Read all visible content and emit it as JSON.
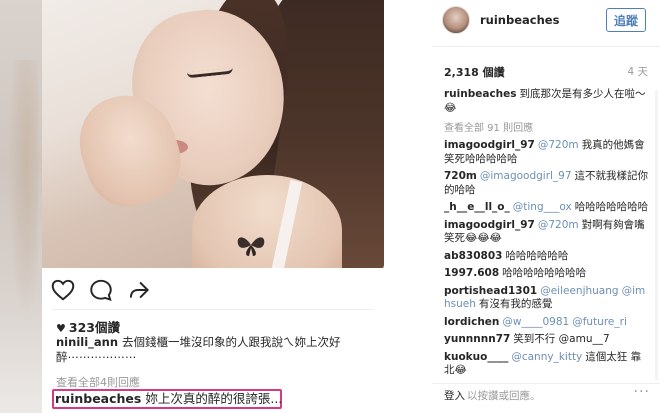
{
  "post": {
    "likes_label": "323個讚",
    "comments": [
      {
        "user": "ninili_ann",
        "text": "去個錢櫃一堆沒印象的人跟我說ㄟ妳上次好醉⋯⋯⋯⋯⋯⋯"
      }
    ],
    "view_all_label": "查看全部4則回應",
    "highlighted_comment": {
      "user": "ruinbeaches",
      "text": "妳上次真的醉的很誇張..."
    }
  },
  "side": {
    "username": "ruinbeaches",
    "follow_label": "追蹤",
    "likes_count": "2,318 個讚",
    "age": "4 天",
    "caption": {
      "user": "ruinbeaches",
      "text": "到底那次是有多少人在啦～😂"
    },
    "view_all_label": "查看全部 91 則回應",
    "comments": [
      {
        "user": "imagoodgirl_97",
        "mentions": [
          "@720m"
        ],
        "text": "我真的他媽會笑死哈哈哈哈哈"
      },
      {
        "user": "720m",
        "mentions": [
          "@imagoodgirl_97"
        ],
        "text": "這不就我樣記你的哈哈"
      },
      {
        "user": "_h__e__ll_o_",
        "mentions": [
          "@ting___ox"
        ],
        "text": "哈哈哈哈哈哈哈"
      },
      {
        "user": "imagoodgirl_97",
        "mentions": [
          "@720m"
        ],
        "text": "對啊有夠會嘴笑死😂😂😂"
      },
      {
        "user": "ab830803",
        "mentions": [],
        "text": "哈哈哈哈哈哈"
      },
      {
        "user": "1997.608",
        "mentions": [],
        "text": "哈哈哈哈哈哈哈哈"
      },
      {
        "user": "portishead1301",
        "mentions": [
          "@eileenjhuang",
          "@imhsueh"
        ],
        "text": "有沒有我的感覺"
      },
      {
        "user": "lordichen",
        "mentions": [
          "@w____0981",
          "@future_ri"
        ],
        "text": ""
      },
      {
        "user": "yunnnnn77",
        "mentions": [],
        "text": "笑到不行 @amu__7"
      },
      {
        "user": "kuokuo____",
        "mentions": [
          "@canny_kitty"
        ],
        "text": "這個太狂 靠北😂"
      }
    ],
    "login_link": "登入",
    "login_hint": "以按讚或回應。",
    "more_label": "···"
  },
  "icons": {
    "heart": "heart-icon",
    "comment": "comment-icon",
    "share": "share-icon",
    "more": "more-icon"
  },
  "colors": {
    "follow_blue": "#4f7fb9",
    "highlight_pink": "#d6397f",
    "mention_blue": "#6f8fb5"
  }
}
